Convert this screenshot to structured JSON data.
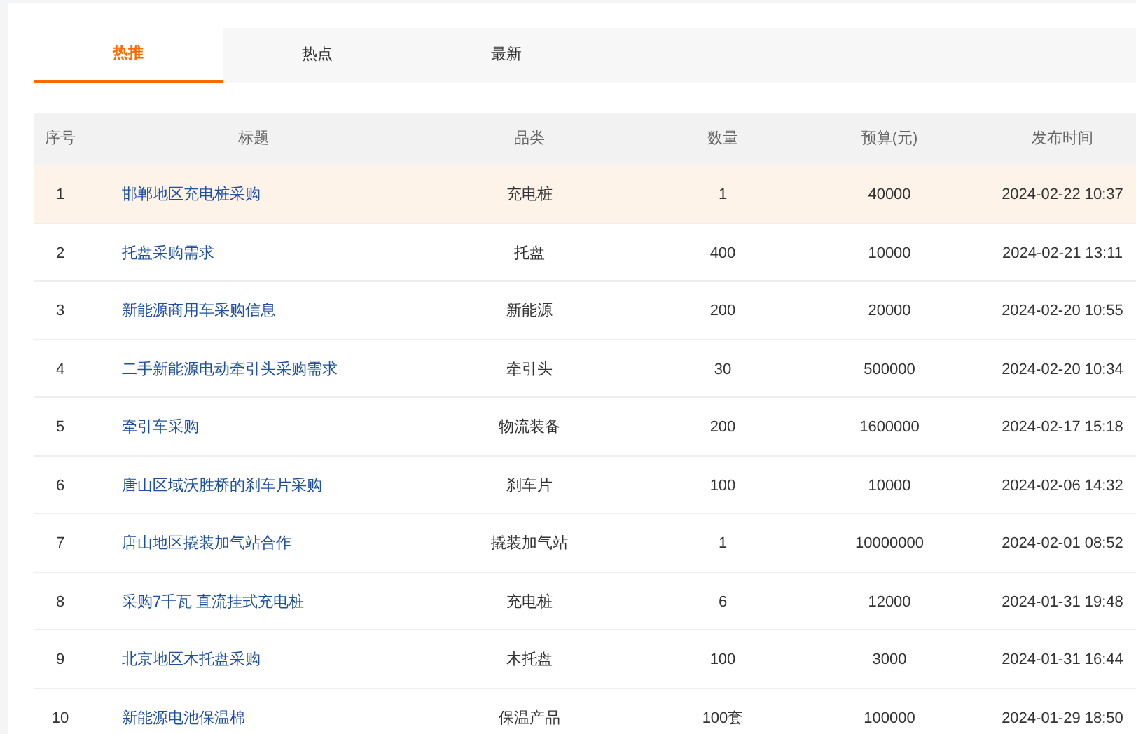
{
  "tabs": [
    {
      "label": "热推",
      "selected": true
    },
    {
      "label": "热点",
      "selected": false
    },
    {
      "label": "最新",
      "selected": false
    }
  ],
  "table": {
    "columns": [
      "序号",
      "标题",
      "品类",
      "数量",
      "预算(元)",
      "发布时间"
    ],
    "rows": [
      {
        "cells": [
          "1",
          "邯郸地区充电桩采购",
          "充电桩",
          "1",
          "40000",
          "2024-02-22 10:37"
        ],
        "highlighted": true
      },
      {
        "cells": [
          "2",
          "托盘采购需求",
          "托盘",
          "400",
          "10000",
          "2024-02-21 13:11"
        ],
        "highlighted": false
      },
      {
        "cells": [
          "3",
          "新能源商用车采购信息",
          "新能源",
          "200",
          "20000",
          "2024-02-20 10:55"
        ],
        "highlighted": false
      },
      {
        "cells": [
          "4",
          "二手新能源电动牵引头采购需求",
          "牵引头",
          "30",
          "500000",
          "2024-02-20 10:34"
        ],
        "highlighted": false
      },
      {
        "cells": [
          "5",
          "牵引车采购",
          "物流装备",
          "200",
          "1600000",
          "2024-02-17 15:18"
        ],
        "highlighted": false
      },
      {
        "cells": [
          "6",
          "唐山区域沃胜桥的刹车片采购",
          "刹车片",
          "100",
          "10000",
          "2024-02-06 14:32"
        ],
        "highlighted": false
      },
      {
        "cells": [
          "7",
          "唐山地区撬装加气站合作",
          "撬装加气站",
          "1",
          "10000000",
          "2024-02-01 08:52"
        ],
        "highlighted": false
      },
      {
        "cells": [
          "8",
          "采购7千瓦 直流挂式充电桩",
          "充电桩",
          "6",
          "12000",
          "2024-01-31 19:48"
        ],
        "highlighted": false
      },
      {
        "cells": [
          "9",
          "北京地区木托盘采购",
          "木托盘",
          "100",
          "3000",
          "2024-01-31 16:44"
        ],
        "highlighted": false
      },
      {
        "cells": [
          "10",
          "新能源电池保温棉",
          "保温产品",
          "100套",
          "100000",
          "2024-01-29 18:50"
        ],
        "highlighted": false
      }
    ]
  }
}
